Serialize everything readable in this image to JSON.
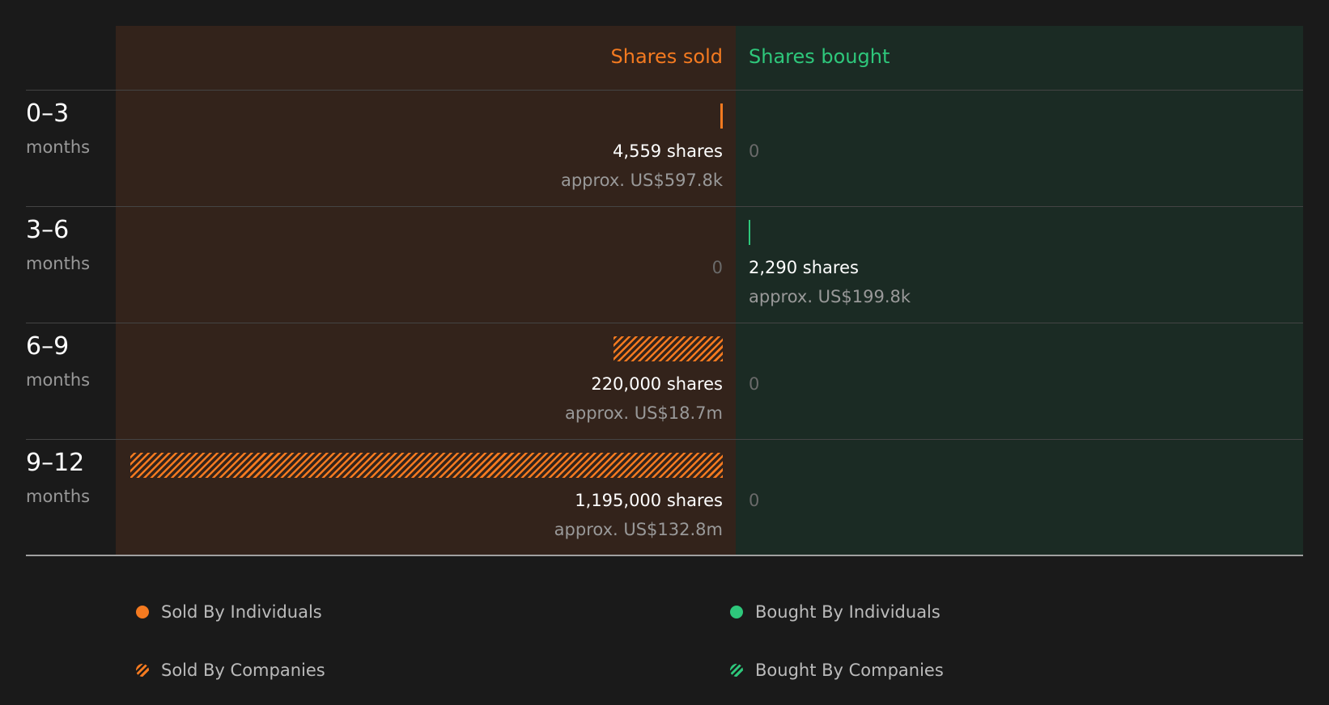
{
  "colors": {
    "sold": "#f47a20",
    "bought": "#2ec77b"
  },
  "headers": {
    "sold": "Shares sold",
    "bought": "Shares bought"
  },
  "rows": [
    {
      "period": "0–3",
      "unit": "months",
      "sold": {
        "shares": "4,559 shares",
        "value": "approx. US$597.8k",
        "zero": ""
      },
      "bought": {
        "shares": "",
        "value": "",
        "zero": "0"
      }
    },
    {
      "period": "3–6",
      "unit": "months",
      "sold": {
        "shares": "",
        "value": "",
        "zero": "0"
      },
      "bought": {
        "shares": "2,290 shares",
        "value": "approx. US$199.8k",
        "zero": ""
      }
    },
    {
      "period": "6–9",
      "unit": "months",
      "sold": {
        "shares": "220,000 shares",
        "value": "approx. US$18.7m",
        "zero": ""
      },
      "bought": {
        "shares": "",
        "value": "",
        "zero": "0"
      }
    },
    {
      "period": "9–12",
      "unit": "months",
      "sold": {
        "shares": "1,195,000 shares",
        "value": "approx. US$132.8m",
        "zero": ""
      },
      "bought": {
        "shares": "",
        "value": "",
        "zero": "0"
      }
    }
  ],
  "legend": [
    {
      "label": "Sold By Individuals",
      "color": "#f47a20",
      "pattern": "solid"
    },
    {
      "label": "Bought By Individuals",
      "color": "#2ec77b",
      "pattern": "solid"
    },
    {
      "label": "Sold By Companies",
      "color": "#f47a20",
      "pattern": "hatched"
    },
    {
      "label": "Bought By Companies",
      "color": "#2ec77b",
      "pattern": "hatched"
    }
  ],
  "chart_data": {
    "type": "bar",
    "orientation": "horizontal",
    "categories": [
      "0–3 months",
      "3–6 months",
      "6–9 months",
      "9–12 months"
    ],
    "series": [
      {
        "name": "Sold By Individuals",
        "values": [
          4559,
          0,
          0,
          0
        ]
      },
      {
        "name": "Sold By Companies",
        "values": [
          0,
          0,
          220000,
          1195000
        ]
      },
      {
        "name": "Bought By Individuals",
        "values": [
          0,
          2290,
          0,
          0
        ]
      },
      {
        "name": "Bought By Companies",
        "values": [
          0,
          0,
          0,
          0
        ]
      }
    ],
    "value_labels": {
      "sold": [
        "4,559 shares",
        "0",
        "220,000 shares",
        "1,195,000 shares"
      ],
      "bought": [
        "0",
        "2,290 shares",
        "0",
        "0"
      ]
    },
    "value_usd_labels": {
      "sold": [
        "approx. US$597.8k",
        "",
        "approx. US$18.7m",
        "approx. US$132.8m"
      ],
      "bought": [
        "",
        "approx. US$199.8k",
        "",
        ""
      ]
    },
    "legend_position": "bottom"
  }
}
